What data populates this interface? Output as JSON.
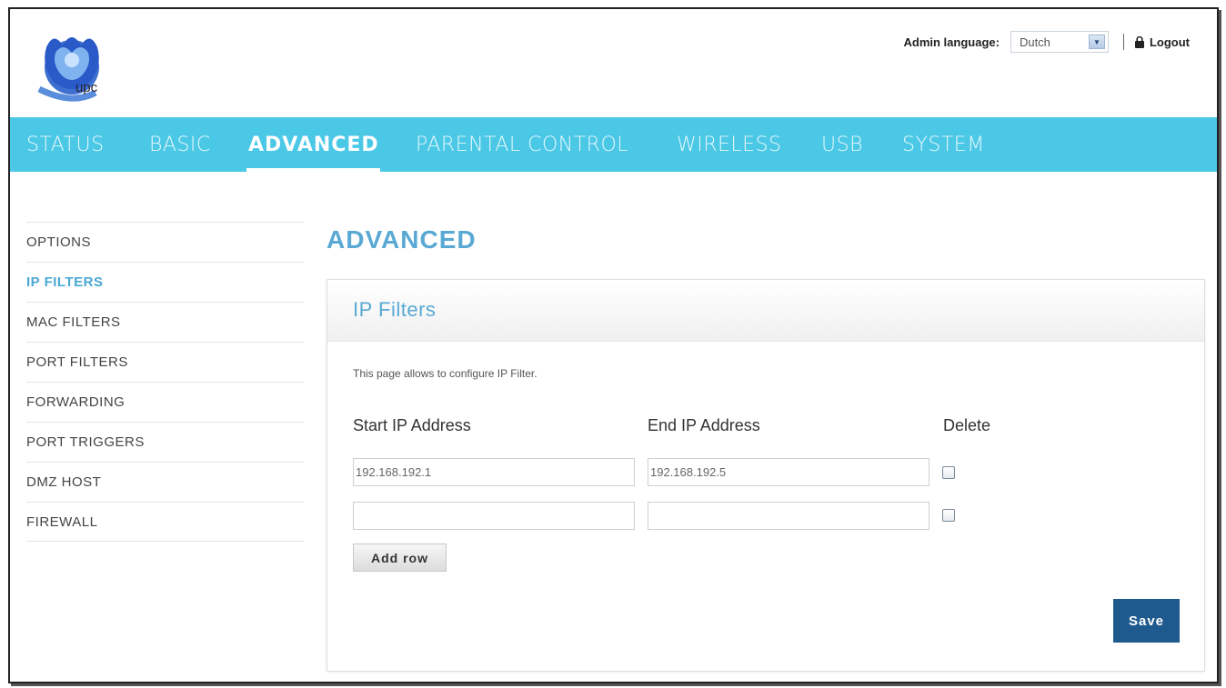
{
  "brand": {
    "logo_text": "upc"
  },
  "topbar": {
    "language_label": "Admin language:",
    "language_value": "Dutch",
    "logout_label": "Logout"
  },
  "nav": {
    "items": [
      "STATUS",
      "BASIC",
      "ADVANCED",
      "PARENTAL CONTROL",
      "WIRELESS",
      "USB",
      "SYSTEM"
    ],
    "active": "ADVANCED"
  },
  "sidebar": {
    "items": [
      "OPTIONS",
      "IP FILTERS",
      "MAC FILTERS",
      "PORT FILTERS",
      "FORWARDING",
      "PORT TRIGGERS",
      "DMZ HOST",
      "FIREWALL"
    ],
    "active": "IP FILTERS"
  },
  "main": {
    "page_title": "ADVANCED",
    "panel_title": "IP Filters",
    "description": "This page allows to configure IP Filter.",
    "columns": {
      "start": "Start IP Address",
      "end": "End IP Address",
      "delete": "Delete"
    },
    "rows": [
      {
        "start": "192.168.192.1",
        "end": "192.168.192.5",
        "delete": false
      },
      {
        "start": "",
        "end": "",
        "delete": false
      }
    ],
    "add_row_label": "Add row",
    "save_label": "Save"
  },
  "colors": {
    "nav_bg": "#4ac8e6",
    "accent": "#59a9d4",
    "save_bg": "#1f5a8e"
  }
}
